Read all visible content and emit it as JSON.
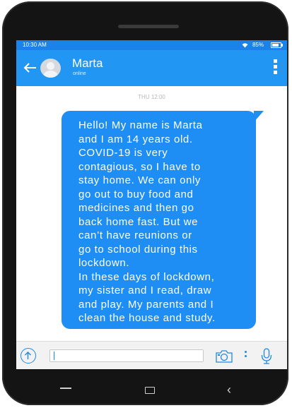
{
  "status_bar": {
    "time": "10:30 AM",
    "battery": "85%"
  },
  "header": {
    "contact_name": "Marta",
    "contact_status": "online"
  },
  "chat": {
    "date_separator": "THU 12:00",
    "message": "Hello! My name is Marta\nand I am 14 years old.\nCOVID-19 is very\ncontagious, so I have to\nstay home. We can only\ngo out to buy food and\nmedicines and then go\nback home fast. But we\ncan’t have reunions or\ngo to school during this\nlockdown.\nIn these days of lockdown,\nmy sister and I read, draw\nand play. My parents and I\nclean the house and study."
  },
  "input_bar": {
    "value": "",
    "placeholder": ""
  },
  "colors": {
    "header": "#2196f3",
    "status_bar": "#1a82e8",
    "bubble": "#1e8ef5",
    "accent": "#1e88e5"
  }
}
